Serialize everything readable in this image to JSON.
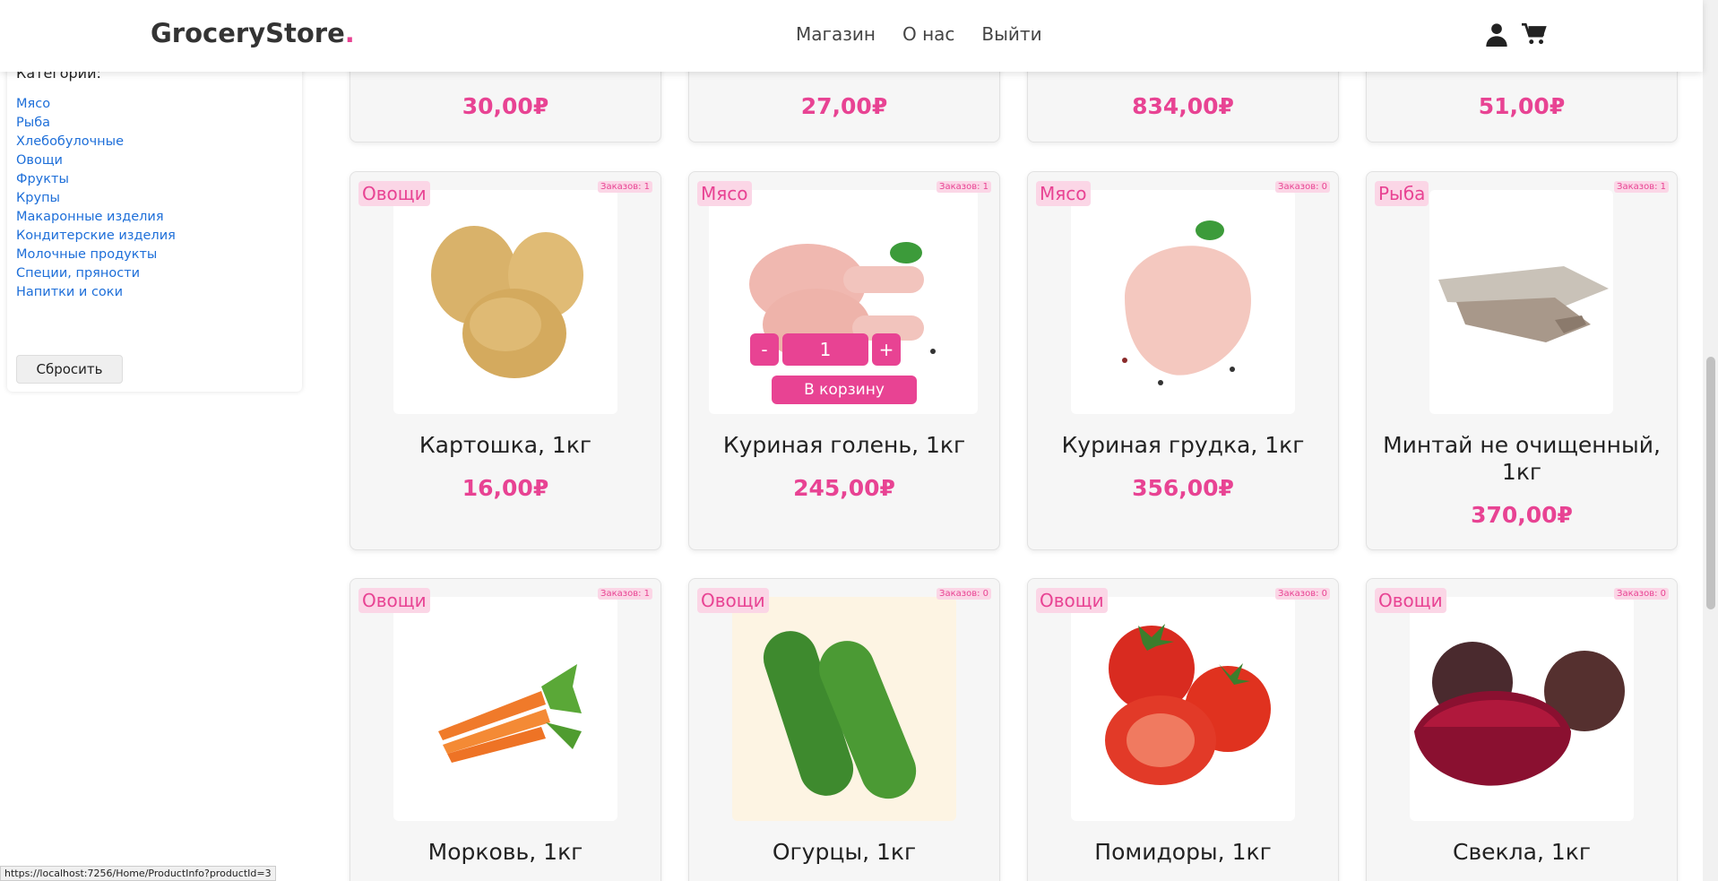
{
  "header": {
    "brand": "GroceryStore",
    "brand_dot": ".",
    "nav": [
      "Магазин",
      "О нас",
      "Выйти"
    ]
  },
  "sidebar": {
    "title": "Категории:",
    "categories": [
      "Мясо",
      "Рыба",
      "Хлебобулочные",
      "Овощи",
      "Фрукты",
      "Крупы",
      "Макаронные изделия",
      "Кондитерские изделия",
      "Молочные продукты",
      "Специи, пряности",
      "Напитки и соки"
    ],
    "reset_label": "Сбросить"
  },
  "top_row_prices": [
    "30,00₽",
    "27,00₽",
    "834,00₽",
    "51,00₽"
  ],
  "products": [
    {
      "category": "Овощи",
      "orders": "Заказов: 1",
      "name": "Картошка, 1кг",
      "price": "16,00₽",
      "image": "potato"
    },
    {
      "category": "Мясо",
      "orders": "Заказов: 1",
      "name": "Куриная голень, 1кг",
      "price": "245,00₽",
      "image": "chicken-leg"
    },
    {
      "category": "Мясо",
      "orders": "Заказов: 0",
      "name": "Куриная грудка, 1кг",
      "price": "356,00₽",
      "image": "chicken-breast"
    },
    {
      "category": "Рыба",
      "orders": "Заказов: 1",
      "name": "Минтай не очищенный, 1кг",
      "price": "370,00₽",
      "image": "fish"
    },
    {
      "category": "Овощи",
      "orders": "Заказов: 1",
      "name": "Морковь, 1кг",
      "price": "",
      "image": "carrot"
    },
    {
      "category": "Овощи",
      "orders": "Заказов: 0",
      "name": "Огурцы, 1кг",
      "price": "",
      "image": "cucumber"
    },
    {
      "category": "Овощи",
      "orders": "Заказов: 0",
      "name": "Помидоры, 1кг",
      "price": "",
      "image": "tomato"
    },
    {
      "category": "Овощи",
      "orders": "Заказов: 0",
      "name": "Свекла, 1кг",
      "price": "",
      "image": "beet"
    }
  ],
  "hover_controls": {
    "minus": "-",
    "qty": "1",
    "plus": "+",
    "add_to_cart": "В корзину"
  },
  "status_url": "https://localhost:7256/Home/ProductInfo?productId=3",
  "colors": {
    "accent": "#e84393",
    "link": "#1e6fd9"
  }
}
